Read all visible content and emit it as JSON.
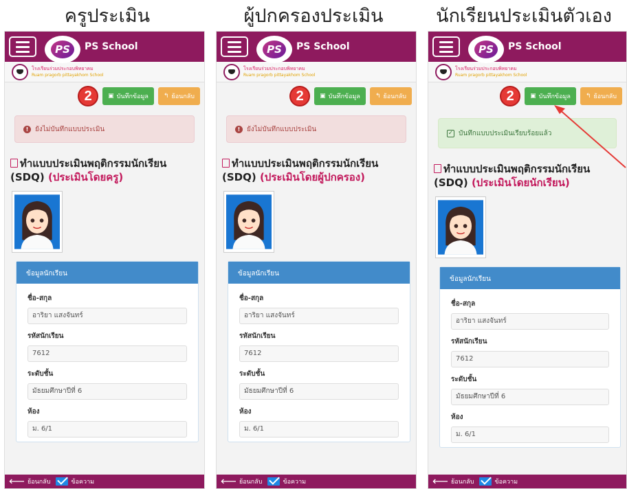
{
  "captions": [
    "ครูประเมิน",
    "ผู้ปกครองประเมิน",
    "นักเรียนประเมินตัวเอง"
  ],
  "app": {
    "title": "PS School",
    "logo_text": "PS",
    "school_name_th": "โรงเรียนร่วมประกอบพิทยาคม",
    "school_name_en": "Ruam pragorb pittayakhom School"
  },
  "toolbar": {
    "badge_number": "2",
    "save_label": "บันทึกข้อมูล",
    "back_label": "ย้อนกลับ"
  },
  "alerts": {
    "not_saved": "ยังไม่บันทึกแบบประเมิน",
    "saved": "บันทึกแบบประเมินเรียบร้อยแล้ว"
  },
  "form": {
    "title": "ทำแบบประเมินพฤติกรรมนักเรียน (SDQ)",
    "by_teacher": "(ประเมินโดยครู)",
    "by_parent": "(ประเมินโดยผู้ปกครอง)",
    "by_student": "(ประเมินโดยนักเรียน)"
  },
  "student": {
    "card_header": "ข้อมูลนักเรียน",
    "name_label": "ชื่อ-สกุล",
    "name_value": "อาริยา แสงจันทร์",
    "id_label": "รหัสนักเรียน",
    "id_value": "7612",
    "level_label": "ระดับชั้น",
    "level_value": "มัธยมศึกษาปีที่ 6",
    "room_label": "ห้อง",
    "room_value": "ม. 6/1",
    "partial_room_value": "ม. 6/1"
  },
  "bottombar": {
    "back_label": "ย้อนกลับ",
    "messages_label": "ข้อความ"
  },
  "colors": {
    "appbar": "#8e1a5e",
    "save_button": "#4caf50",
    "back_button": "#f0ad4e",
    "badge": "#e53935",
    "info_header": "#428bca",
    "arrow": "#e53935"
  }
}
